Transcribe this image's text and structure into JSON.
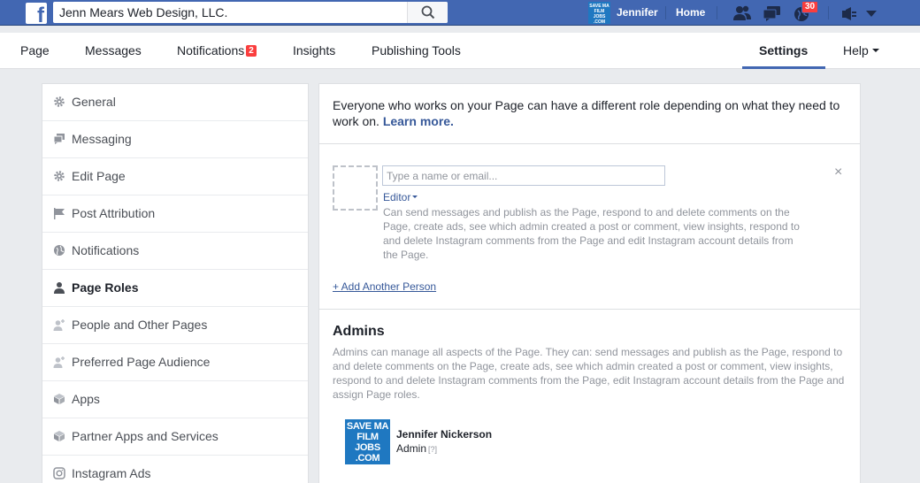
{
  "topbar": {
    "search_value": "Jenn Mears Web Design, LLC.",
    "user_name": "Jennifer",
    "home_label": "Home",
    "notification_count": "30",
    "avatar_text": "SAVE MA FILM JOBS .COM",
    "brand_color": "#4267b2"
  },
  "pagenav": {
    "tabs": [
      {
        "label": "Page"
      },
      {
        "label": "Messages"
      },
      {
        "label": "Notifications",
        "badge": "2"
      },
      {
        "label": "Insights"
      },
      {
        "label": "Publishing Tools"
      }
    ],
    "settings_label": "Settings",
    "help_label": "Help"
  },
  "sidebar": {
    "items": [
      {
        "label": "General",
        "icon": "gear-icon"
      },
      {
        "label": "Messaging",
        "icon": "chat-icon"
      },
      {
        "label": "Edit Page",
        "icon": "gear-icon"
      },
      {
        "label": "Post Attribution",
        "icon": "flag-icon"
      },
      {
        "label": "Notifications",
        "icon": "globe-icon"
      },
      {
        "label": "Page Roles",
        "icon": "person-icon",
        "active": true
      },
      {
        "label": "People and Other Pages",
        "icon": "person-add-icon"
      },
      {
        "label": "Preferred Page Audience",
        "icon": "person-add-icon"
      },
      {
        "label": "Apps",
        "icon": "cube-icon"
      },
      {
        "label": "Partner Apps and Services",
        "icon": "cube-icon"
      },
      {
        "label": "Instagram Ads",
        "icon": "instagram-icon"
      }
    ]
  },
  "main": {
    "intro_text": "Everyone who works on your Page can have a different role depending on what they need to work on.",
    "learn_more": "Learn more.",
    "name_placeholder": "Type a name or email...",
    "role_label": "Editor",
    "role_description": "Can send messages and publish as the Page, respond to and delete comments on the Page, create ads, see which admin created a post or comment, view insights, respond to and delete Instagram comments from the Page and edit Instagram account details from the Page.",
    "close_symbol": "×",
    "add_person": "+ Add Another Person",
    "admins_title": "Admins",
    "admins_description": "Admins can manage all aspects of the Page. They can: send messages and publish as the Page, respond to and delete comments on the Page, create ads, see which admin created a post or comment, view insights, respond to and delete Instagram comments from the Page, edit Instagram account details from the Page and assign Page roles.",
    "admin": {
      "avatar_text": "SAVE MA FILM JOBS .COM",
      "name": "Jennifer Nickerson",
      "role": "Admin",
      "help": "[?]"
    }
  }
}
